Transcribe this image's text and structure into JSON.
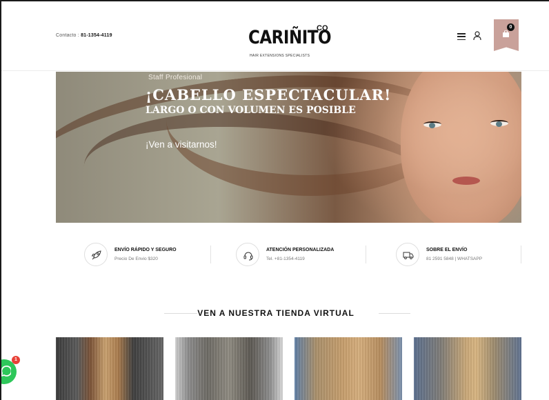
{
  "header": {
    "contact_label": "Contacto : ",
    "contact_phone": "81-1354-4119",
    "logo_text": "CARIÑITO",
    "logo_sup": "CO",
    "logo_tagline": "HAIR EXTENSIONS SPECIALISTS",
    "cart_count": "0",
    "cart_color": "#c9a19a"
  },
  "hero": {
    "kicker": "Staff Profesional",
    "headline": "¡CABELLO ESPECTACULAR!",
    "subheadline": "LARGO O CON VOLUMEN ES POSIBLE",
    "cta": "¡Ven a visitarnos!"
  },
  "features": [
    {
      "icon": "rocket-icon",
      "title": "ENVÍO RÁPIDO Y SEGURO",
      "subtitle": "Precio De Envio $320"
    },
    {
      "icon": "headset-icon",
      "title": "ATENCIÓN PERSONALIZADA",
      "subtitle": "Tel. +81-1354-4119"
    },
    {
      "icon": "truck-icon",
      "title": "SOBRE EL ENVÍO",
      "subtitle": "81 2591 5848 | WHATSAPP"
    }
  ],
  "section": {
    "title": "VEN A NUESTRA TIENDA VIRTUAL"
  },
  "whatsapp": {
    "badge": "1",
    "color": "#2ec75a"
  }
}
